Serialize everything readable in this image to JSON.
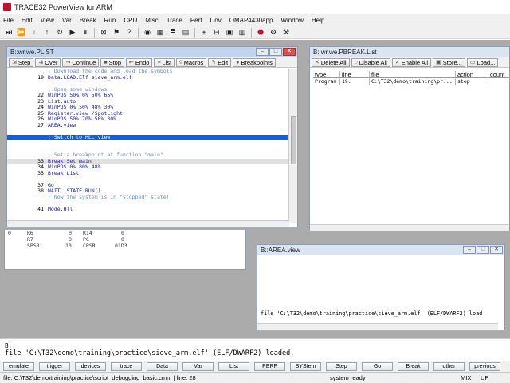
{
  "app": {
    "title": "TRACE32 PowerView for ARM"
  },
  "menu": [
    "File",
    "Edit",
    "View",
    "Var",
    "Break",
    "Run",
    "CPU",
    "Misc",
    "Trace",
    "Perf",
    "Cov",
    "OMAP4430app",
    "Window",
    "Help"
  ],
  "plist": {
    "title": "B::wr.we.PLIST",
    "buttons": [
      "Step",
      "Over",
      "Continue",
      "Stop",
      "Endo",
      "List",
      "Macros",
      "Edit",
      "Breakpoints"
    ],
    "lines": [
      {
        "ln": "",
        "text": "; Download the code and load the symbols",
        "kind": "comment"
      },
      {
        "ln": "19",
        "text": "Data.LOAD.Elf sieve_arm.elf",
        "kind": "code"
      },
      {
        "ln": "",
        "text": "",
        "kind": "code"
      },
      {
        "ln": "",
        "text": "; Open some windows",
        "kind": "comment"
      },
      {
        "ln": "22",
        "text": "WinPOS 50% 0% 50% 65%",
        "kind": "code"
      },
      {
        "ln": "23",
        "text": "List.auto",
        "kind": "code"
      },
      {
        "ln": "24",
        "text": "WinPOS 0% 50% 48% 30%",
        "kind": "code"
      },
      {
        "ln": "25",
        "text": "Register.view /SpotLight",
        "kind": "code"
      },
      {
        "ln": "26",
        "text": "WinPOS 50% 70% 50% 30%",
        "kind": "code"
      },
      {
        "ln": "27",
        "text": "AREA.view",
        "kind": "code"
      },
      {
        "ln": "",
        "text": "",
        "kind": "code"
      },
      {
        "ln": "",
        "text": "; Switch to HLL view",
        "kind": "hl"
      },
      {
        "ln": "",
        "text": "",
        "kind": "code"
      },
      {
        "ln": "",
        "text": "",
        "kind": "code"
      },
      {
        "ln": "",
        "text": "; Set a breakpoint at function \"main\"",
        "kind": "comment"
      },
      {
        "ln": "33",
        "text": "Break.Set main",
        "kind": "bp"
      },
      {
        "ln": "34",
        "text": "WinPOS 0% 80% 48%",
        "kind": "code"
      },
      {
        "ln": "35",
        "text": "Break.List",
        "kind": "code"
      },
      {
        "ln": "",
        "text": "",
        "kind": "code"
      },
      {
        "ln": "37",
        "text": "Go",
        "kind": "code"
      },
      {
        "ln": "38",
        "text": "WAIT !STATE.RUN()",
        "kind": "code"
      },
      {
        "ln": "",
        "text": "; Now the system is in \"stopped\" state!",
        "kind": "comment"
      },
      {
        "ln": "",
        "text": "",
        "kind": "code"
      },
      {
        "ln": "41",
        "text": "Mode.Hll",
        "kind": "code"
      }
    ]
  },
  "pbreak": {
    "title": "B::wr.we.PBREAK.List",
    "buttons": [
      "Delete All",
      "Disable All",
      "Enable All",
      "Store...",
      "Load..."
    ],
    "columns": [
      "type",
      "line",
      "file",
      "action",
      "count"
    ],
    "rows": [
      [
        "Program",
        "19.",
        "C:\\T32\\demo\\training\\pr...",
        "stop",
        ""
      ]
    ]
  },
  "regs": {
    "rows": [
      {
        "l": "0",
        "r1": "R6",
        "v1": "0",
        "r2": "R14",
        "v2": "0"
      },
      {
        "l": "",
        "r1": "R7",
        "v1": "0",
        "r2": "PC",
        "v2": "0"
      },
      {
        "l": "",
        "r1": "SPSR",
        "v1": "10",
        "r2": "CPSR",
        "v2": "01D3"
      }
    ]
  },
  "area": {
    "title": "B::AREA.view",
    "text": "file 'C:\\T32\\demo\\training\\practice\\sieve_arm.elf' (ELF/DWARF2) load"
  },
  "cmd": {
    "prompt": "B::",
    "message": "file 'C:\\T32\\demo\\training\\practice\\sieve_arm.elf' (ELF/DWARF2) loaded."
  },
  "softkeys": [
    "emulate",
    "trigger",
    "devices",
    "trace",
    "Data",
    "Var",
    "List",
    "PERF",
    "SYStem",
    "Step",
    "Go",
    "Break",
    "other",
    "previous"
  ],
  "status": {
    "file": "file: C:\\T32\\demo\\training\\practice\\script_debugging_basic.cmm | line: 28",
    "state": "system ready",
    "mix": "MIX",
    "up": "UP"
  }
}
